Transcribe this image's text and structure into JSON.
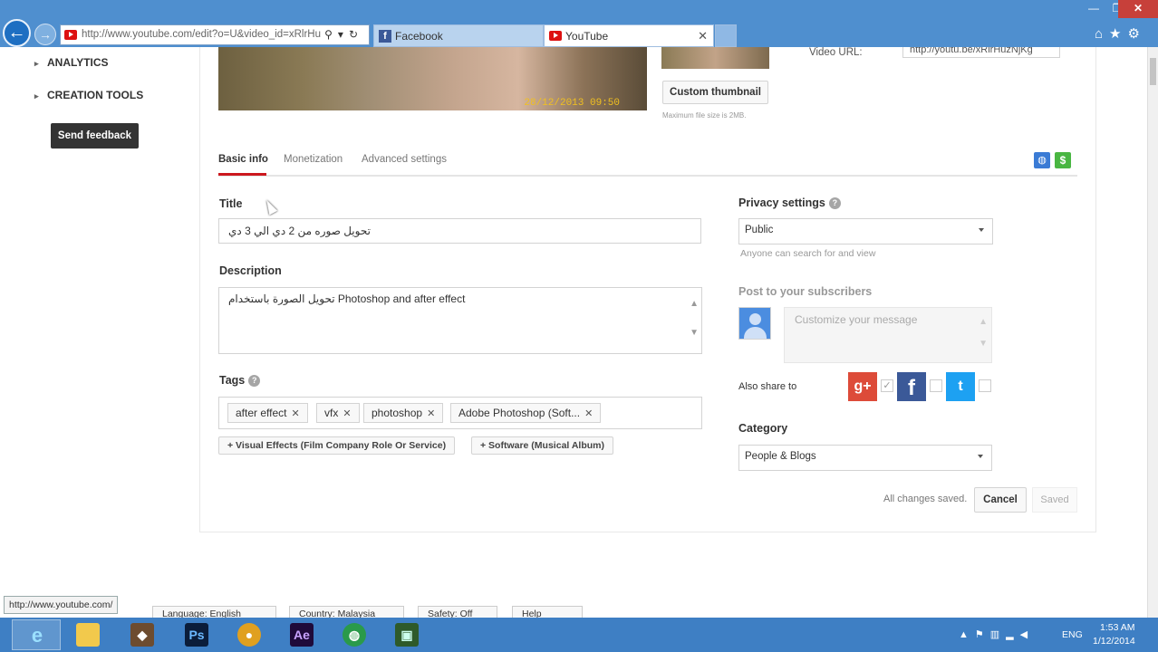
{
  "browser": {
    "address": "http://www.youtube.com/edit?o=U&video_id=xRlrHu",
    "tabs": [
      {
        "label": "Facebook",
        "active": false
      },
      {
        "label": "YouTube",
        "active": true
      }
    ],
    "window_close": "✕",
    "window_min": "—",
    "window_max": "❐"
  },
  "nav": {
    "items": [
      "ANALYTICS",
      "CREATION TOOLS"
    ],
    "send_feedback": "Send feedback"
  },
  "video": {
    "timestamp": "28/12/2013 09:50",
    "custom_thumbnail": "Custom thumbnail",
    "max_file": "Maximum file size is 2MB.",
    "url_label": "Video URL:",
    "url_value": "http://youtu.be/xRlrHuzNjKg"
  },
  "tabs": [
    "Basic info",
    "Monetization",
    "Advanced settings"
  ],
  "form": {
    "title_label": "Title",
    "title_value": "تحويل صوره من 2 دي الي 3 دي",
    "description_label": "Description",
    "description_value": "تحويل الصورة باستخدام Photoshop and after effect",
    "tags_label": "Tags",
    "tags": [
      "after effect",
      "vfx",
      "photoshop",
      "Adobe Photoshop (Soft..."
    ],
    "suggested": [
      "+ Visual Effects (Film Company Role Or Service)",
      "+ Software (Musical Album)"
    ]
  },
  "privacy": {
    "label": "Privacy settings",
    "value": "Public",
    "hint": "Anyone can search for and view"
  },
  "post": {
    "label": "Post to your subscribers",
    "placeholder": "Customize your message",
    "also_share": "Also share to"
  },
  "category": {
    "label": "Category",
    "value": "People & Blogs"
  },
  "actions": {
    "status": "All changes saved.",
    "cancel": "Cancel",
    "saved": "Saved"
  },
  "status_url": "http://www.youtube.com/",
  "footer": [
    "Language: English",
    "Country: Malaysia",
    "Safety: Off",
    "Help"
  ],
  "taskbar": {
    "lang": "ENG",
    "time": "1:53 AM",
    "date": "1/12/2014"
  },
  "colors": {
    "chrome": "#4f8fcf",
    "taskbar": "#3e7fc4",
    "accent_red": "#cc181e"
  }
}
